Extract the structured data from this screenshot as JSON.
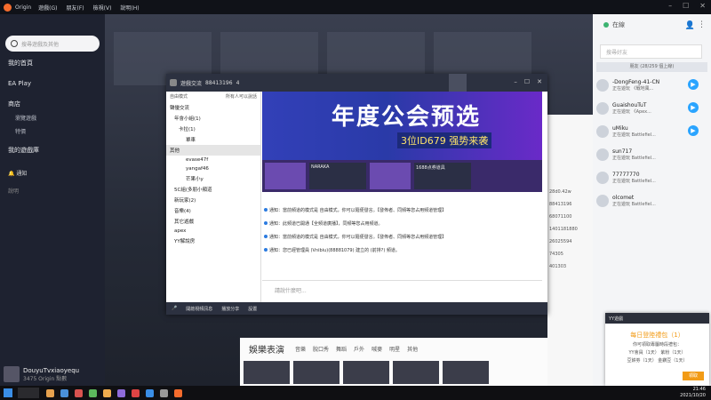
{
  "origin": {
    "title": "Origin",
    "menu": [
      "遊戲(G)",
      "朋友(F)",
      "檢視(V)",
      "說明(H)"
    ],
    "search_placeholder": "搜尋遊戲及其他",
    "nav": [
      "我的首頁",
      "EA Play",
      "商店"
    ],
    "sub_nav": [
      "瀏覽遊戲",
      "特價"
    ],
    "library": "我的遊戲庫",
    "notifications": "通知",
    "help": "說明",
    "user": {
      "name": "DouyuTvxiaoyequ",
      "sub": "3475 Origin 點數"
    }
  },
  "friends": {
    "status": "在線",
    "search_placeholder": "搜尋好友",
    "count": "朋友 (28/259 個上線)",
    "items": [
      {
        "name": "-DongFeng-41-CN",
        "status": "正在遊玩 《戰地風..."
      },
      {
        "name": "GuaishouTuT",
        "status": "正在遊玩 《Apex..."
      },
      {
        "name": "uMiku",
        "status": "正在遊玩 Battlefiel..."
      },
      {
        "name": "sun717",
        "status": "正在遊玩 Battlefiel..."
      },
      {
        "name": "77777770",
        "status": "正在遊玩 Battlefiel..."
      },
      {
        "name": "olcomet",
        "status": "正在遊玩 Battlefiel..."
      }
    ]
  },
  "yy": {
    "channel": "遊戲交流",
    "id": "88413196",
    "online": "4",
    "left_header_left": "自由模式",
    "left_header_right": "所有人可以說話",
    "tree": [
      {
        "text": "聲優交流",
        "cls": "row"
      },
      {
        "text": "年會小組(1)",
        "cls": "row in1"
      },
      {
        "text": "卡拉(1)",
        "cls": "row in2"
      },
      {
        "text": "單車",
        "cls": "row in3"
      },
      {
        "text": "其他",
        "cls": "row sel"
      },
      {
        "text": "evase47f",
        "cls": "row in3"
      },
      {
        "text": "yangaf46",
        "cls": "row in3"
      },
      {
        "text": "芒果小y",
        "cls": "row in3"
      },
      {
        "text": "5C組(多朋小頻道",
        "cls": "row in1"
      },
      {
        "text": "新玩家(2)",
        "cls": "row in1"
      },
      {
        "text": "音樂(4)",
        "cls": "row in1"
      },
      {
        "text": "其它遊戲",
        "cls": "row in1"
      },
      {
        "text": "apex",
        "cls": "row in1"
      },
      {
        "text": "YY解說房",
        "cls": "row in1"
      }
    ],
    "banner_title": "年度公会预选",
    "banner_sub": "3位ID679 强势来袭",
    "cards": [
      "NARAKA",
      "1688点券道具"
    ],
    "messages": [
      "通知：當前頻道的模式是 自由模式，你可以隨便發言。【發佈者、同頻等您占用頻道管理】",
      "通知：此頻道已開通【全頻道廣播】，同頻等您占用頻道。",
      "通知：當前頻道的模式是 自由模式，你可以隨便發言。【發佈者、同頻等您占用頻道管理】",
      "通知：您已經管理員 (Vnibiu)(88881079) 建立的 (前排?) 頻道。"
    ],
    "input_placeholder": "請說什麼吧...",
    "bottom": [
      "開啟視頻訊息",
      "播放分享",
      "設置"
    ]
  },
  "panel2": {
    "lines": [
      "28d0.42w",
      "88413196",
      "68071100",
      "1401181880",
      "26025594",
      "74305",
      "401303"
    ]
  },
  "ent": {
    "title": "娛樂表演",
    "cats": [
      "音樂",
      "脫口秀",
      "舞蹈",
      "戶外",
      "喊麥",
      "明星",
      "其他"
    ]
  },
  "popup": {
    "header": "YY遊戲",
    "title": "每日登陸禮包（1）",
    "lines": [
      "你可領取專屬時段禮包：",
      "YY會員（1天） 紫粉（1天）",
      "豆餅劵（1天） 金鑽豆（1天）"
    ],
    "button": "領取"
  },
  "taskbar": {
    "time": "21:46",
    "date": "2021/10/20"
  }
}
